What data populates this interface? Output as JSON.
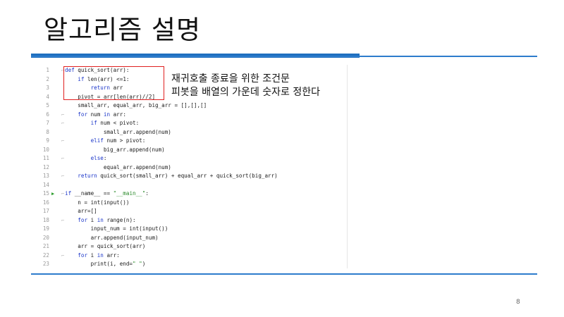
{
  "slide": {
    "title": "알고리즘 설명",
    "page_number": "8"
  },
  "notes": [
    "재귀호출 종료을 위한 조건문",
    "피봇을 배열의 가운데 숫자로 정한다"
  ],
  "code": {
    "lines": [
      {
        "n": "1",
        "text": "def quick_sort(arr):"
      },
      {
        "n": "2",
        "text": "    if len(arr) <=1:"
      },
      {
        "n": "3",
        "text": "        return arr"
      },
      {
        "n": "4",
        "text": "    pivot = arr[len(arr)//2]"
      },
      {
        "n": "5",
        "text": "    small_arr, equal_arr, big_arr = [],[],[]"
      },
      {
        "n": "6",
        "text": "    for num in arr:"
      },
      {
        "n": "7",
        "text": "        if num < pivot:"
      },
      {
        "n": "8",
        "text": "            small_arr.append(num)"
      },
      {
        "n": "9",
        "text": "        elif num > pivot:"
      },
      {
        "n": "10",
        "text": "            big_arr.append(num)"
      },
      {
        "n": "11",
        "text": "        else:"
      },
      {
        "n": "12",
        "text": "            equal_arr.append(num)"
      },
      {
        "n": "13",
        "text": "    return quick_sort(small_arr) + equal_arr + quick_sort(big_arr)"
      },
      {
        "n": "14",
        "text": ""
      },
      {
        "n": "15",
        "text": "if __name__ == \"__main__\":"
      },
      {
        "n": "16",
        "text": "    n = int(input())"
      },
      {
        "n": "17",
        "text": "    arr=[]"
      },
      {
        "n": "18",
        "text": "    for i in range(n):"
      },
      {
        "n": "19",
        "text": "        input_num = int(input())"
      },
      {
        "n": "20",
        "text": "        arr.append(input_num)"
      },
      {
        "n": "21",
        "text": "    arr = quick_sort(arr)"
      },
      {
        "n": "22",
        "text": "    for i in arr:"
      },
      {
        "n": "23",
        "text": "        print(i, end=\" \")"
      }
    ],
    "run_line": "15",
    "run_icon": "play-icon"
  },
  "colors": {
    "accent_blue": "#1f6fbf",
    "keyword": "#1a35c9",
    "string": "#2a8a2a",
    "highlight_box": "#e02020"
  }
}
